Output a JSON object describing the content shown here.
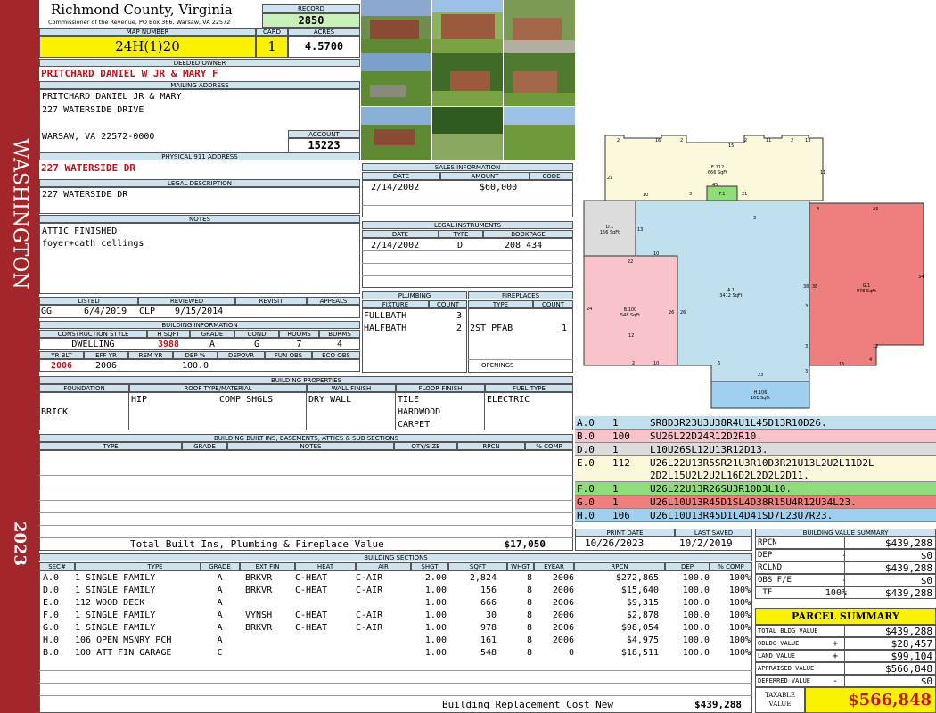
{
  "side": {
    "top": "WASHINGTON",
    "bottom": "2023"
  },
  "county": {
    "name": "Richmond County, Virginia",
    "sub": "Commissioner of the Revenue, PO Box 366, Warsaw, VA 22572"
  },
  "record": {
    "label": "RECORD",
    "value": "2850"
  },
  "map": {
    "label": "MAP NUMBER",
    "value": "24H(1)20",
    "card_label": "CARD",
    "card": "1",
    "acres_label": "ACRES",
    "acres": "4.5700"
  },
  "owner": {
    "label": "DEEDED OWNER",
    "value": "PRITCHARD DANIEL W JR & MARY F"
  },
  "mailing": {
    "label": "MAILING ADDRESS",
    "line1": "PRITCHARD DANIEL JR & MARY",
    "line2": "227 WATERSIDE DRIVE",
    "line3": "WARSAW, VA 22572-0000"
  },
  "account": {
    "label": "ACCOUNT",
    "value": "15223"
  },
  "physical": {
    "label": "PHYSICAL 911 ADDRESS",
    "value": "227 WATERSIDE DR"
  },
  "legal": {
    "label": "LEGAL DESCRIPTION",
    "value": "227 WATERSIDE DR"
  },
  "notes": {
    "label": "NOTES",
    "line1": "ATTIC FINISHED",
    "line2": "foyer+cath cellings"
  },
  "review": {
    "listed_label": "LISTED",
    "reviewed_label": "REVIEWED",
    "revisit_label": "REVISIT",
    "appeals_label": "APPEALS",
    "listed_by": "GG",
    "listed_date": "6/4/2019",
    "reviewed_by": "CLP",
    "reviewed_date": "9/15/2014"
  },
  "bldg_info": {
    "label": "BUILDING INFORMATION",
    "h": [
      "CONSTRUCTION STYLE",
      "H SQFT",
      "GRADE",
      "COND",
      "ROOMS",
      "BDRMS"
    ],
    "v": [
      "DWELLING",
      "3988",
      "A",
      "G",
      "7",
      "4"
    ],
    "h2": [
      "YR BLT",
      "EFF YR",
      "REM YR",
      "DEP %",
      "DEPOVR",
      "FUN OBS",
      "ECO OBS"
    ],
    "v2": [
      "2006",
      "2006",
      "",
      "100.0",
      "",
      "",
      ""
    ]
  },
  "sales": {
    "label": "SALES INFORMATION",
    "h": [
      "DATE",
      "AMOUNT",
      "CODE"
    ],
    "date": "2/14/2002",
    "amount": "$60,000"
  },
  "instruments": {
    "label": "LEGAL INSTRUMENTS",
    "h": [
      "DATE",
      "TYPE",
      "BOOKPAGE"
    ],
    "date": "2/14/2002",
    "type": "D",
    "book": "208 434"
  },
  "plumbing": {
    "label": "PLUMBING",
    "h": [
      "FIXTURE",
      "COUNT"
    ],
    "r1": [
      "FULLBATH",
      "3"
    ],
    "r2": [
      "HALFBATH",
      "2"
    ]
  },
  "fireplaces": {
    "label": "FIREPLACES",
    "h": [
      "TYPE",
      "COUNT"
    ],
    "r1": [
      "2ST PFAB",
      "1"
    ],
    "openings": "OPENINGS"
  },
  "props": {
    "label": "BUILDING PROPERTIES",
    "h": [
      "FOUNDATION",
      "ROOF TYPE/MATERIAL",
      "WALL FINISH",
      "FLOOR FINISH",
      "FUEL TYPE"
    ],
    "foundation": "BRICK",
    "roof_type": "HIP",
    "roof_mat": "COMP SHGLS",
    "wall": "DRY WALL",
    "floor1": "TILE",
    "floor2": "HARDWOOD",
    "floor3": "CARPET",
    "fuel": "ELECTRIC"
  },
  "builtins": {
    "label": "BUILDING BUILT INS, BASEMENTS, ATTICS & SUB SECTIONS",
    "h": [
      "TYPE",
      "GRADE",
      "NOTES",
      "QTY/SIZE",
      "RPCN",
      "% COMP"
    ],
    "total_label": "Total Built Ins, Plumbing & Fireplace Value",
    "total": "$17,050"
  },
  "sections": {
    "label": "BUILDING SECTIONS",
    "h": [
      "SEC#",
      "TYPE",
      "GRADE",
      "EXT FIN",
      "HEAT",
      "AIR",
      "SHGT",
      "SQFT",
      "WHGT",
      "EYEAR",
      "RPCN",
      "DEP",
      "% COMP"
    ],
    "rows": [
      [
        "A.0",
        "1 SINGLE FAMILY",
        "A",
        "BRKVR",
        "C-HEAT",
        "C-AIR",
        "2.00",
        "2,824",
        "8",
        "2006",
        "$272,865",
        "100.0",
        "100%"
      ],
      [
        "D.0",
        "1 SINGLE FAMILY",
        "A",
        "BRKVR",
        "C-HEAT",
        "C-AIR",
        "1.00",
        "156",
        "8",
        "2006",
        "$15,640",
        "100.0",
        "100%"
      ],
      [
        "E.0",
        "112 WOOD DECK",
        "A",
        "",
        "",
        "",
        "1.00",
        "666",
        "8",
        "2006",
        "$9,315",
        "100.0",
        "100%"
      ],
      [
        "F.0",
        "1 SINGLE FAMILY",
        "A",
        "VYNSH",
        "C-HEAT",
        "C-AIR",
        "1.00",
        "30",
        "8",
        "2006",
        "$2,878",
        "100.0",
        "100%"
      ],
      [
        "G.0",
        "1 SINGLE FAMILY",
        "A",
        "BRKVR",
        "C-HEAT",
        "C-AIR",
        "1.00",
        "978",
        "8",
        "2006",
        "$98,054",
        "100.0",
        "100%"
      ],
      [
        "H.0",
        "106 OPEN MSNRY PCH",
        "A",
        "",
        "",
        "",
        "1.00",
        "161",
        "8",
        "2006",
        "$4,975",
        "100.0",
        "100%"
      ],
      [
        "B.0",
        "100 ATT FIN GARAGE",
        "C",
        "",
        "",
        "",
        "1.00",
        "548",
        "8",
        "0",
        "$18,511",
        "100.0",
        "100%"
      ]
    ],
    "total_label": "Building Replacement Cost New",
    "total": "$439,288"
  },
  "codes": [
    {
      "sec": "A.0",
      "n": "1",
      "code": "SR8D3R23U3U38R4U1L45D13R10D26.",
      "color": "#bfe0ec"
    },
    {
      "sec": "B.0",
      "n": "100",
      "code": "SU26L22D24R12D2R10.",
      "color": "#f9c3cc"
    },
    {
      "sec": "D.0",
      "n": "1",
      "code": "L10U26SL12U13R12D13.",
      "color": "#dcdcdc"
    },
    {
      "sec": "E.0",
      "n": "112",
      "code": "U26L22U13R5SR21U3R10D3R21U13L2U2L11D2L",
      "code2": "2D2L15U2L2U2L16D2L2D2L2D11.",
      "color": "#fcf8dc"
    },
    {
      "sec": "F.0",
      "n": "1",
      "code": "U26L22U13R26SU3R10D3L10.",
      "color": "#8fdd7a"
    },
    {
      "sec": "G.0",
      "n": "1",
      "code": "U26L10U13R45D1SL4D38R15U4R12U34L23.",
      "color": "#ef7e7e"
    },
    {
      "sec": "H.0",
      "n": "106",
      "code": "U26L10U13R45D1L4D41SD7L23U7R23.",
      "color": "#9fd0ef"
    }
  ],
  "dates": {
    "print_label": "PRINT DATE",
    "print": "10/26/2023",
    "saved_label": "LAST SAVED",
    "saved": "10/2/2019"
  },
  "value_summary": {
    "label": "BUILDING VALUE SUMMARY",
    "rows": [
      [
        "RPCN",
        "",
        "$439,288"
      ],
      [
        "DEP",
        "-",
        "$0"
      ],
      [
        "RCLND",
        "",
        "$439,288"
      ],
      [
        "OBS F/E",
        "-",
        "$0"
      ],
      [
        "LTF",
        "100%",
        "$439,288"
      ]
    ]
  },
  "parcel": {
    "label": "PARCEL SUMMARY",
    "rows": [
      [
        "TOTAL BLDG VALUE",
        "",
        "$439,288"
      ],
      [
        "OBLDG VALUE",
        "+",
        "$28,457"
      ],
      [
        "LAND VALUE",
        "+",
        "$99,104"
      ],
      [
        "APPRAISED VALUE",
        "",
        "$566,848"
      ],
      [
        "DEFERRED VALUE",
        "-",
        "$0"
      ]
    ],
    "taxable_label": "TAXABLE VALUE",
    "taxable": "$566,848"
  },
  "sketch": {
    "labels": [
      {
        "id": "E.112",
        "s": "E.112",
        "t": "666 SqFt"
      },
      {
        "id": "F1",
        "s": "F.1",
        "t": ""
      },
      {
        "id": "D1",
        "s": "D.1",
        "t": "156 SqFt"
      },
      {
        "id": "A1",
        "s": "A.1",
        "t": "3412 SqFt"
      },
      {
        "id": "G1",
        "s": "G.1",
        "t": "978 SqFt"
      },
      {
        "id": "B100",
        "s": "B.100",
        "t": "548 SqFt"
      },
      {
        "id": "H106",
        "s": "H.106",
        "t": "161 SqFt"
      }
    ],
    "dims": [
      "2",
      "16",
      "2",
      "15",
      "2",
      "11",
      "2",
      "13",
      "11",
      "21",
      "10",
      "45",
      "3",
      "3",
      "21",
      "4",
      "23",
      "34",
      "12",
      "15",
      "4",
      "3",
      "3",
      "23",
      "3",
      "6",
      "10",
      "2",
      "12",
      "26",
      "26",
      "24",
      "22",
      "38",
      "38",
      "10",
      "13"
    ]
  },
  "colors": {
    "side": "#a3262a",
    "header": "#cfe3ef",
    "yellow": "#fbf200",
    "red": "#c0141b"
  }
}
